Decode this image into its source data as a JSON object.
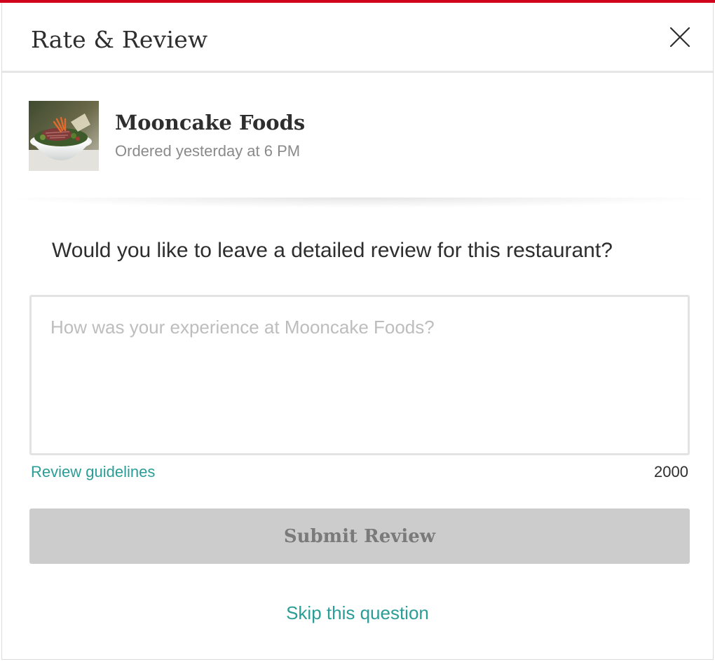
{
  "dialog": {
    "title": "Rate & Review",
    "close_icon": "close-icon",
    "accent_color": "#d0021b"
  },
  "restaurant": {
    "name": "Mooncake Foods",
    "order_time": "Ordered yesterday at 6 PM",
    "thumbnail": "food-bowl-photo"
  },
  "review": {
    "question": "Would you like to leave a detailed review for this restaurant?",
    "placeholder": "How was your experience at Mooncake Foods?",
    "value": "",
    "guidelines_label": "Review guidelines",
    "char_count": "2000",
    "submit_label": "Submit Review",
    "skip_label": "Skip this question"
  },
  "colors": {
    "link": "#2a9d97",
    "button_disabled_bg": "#cccccc",
    "button_disabled_text": "#7a7a7a"
  }
}
